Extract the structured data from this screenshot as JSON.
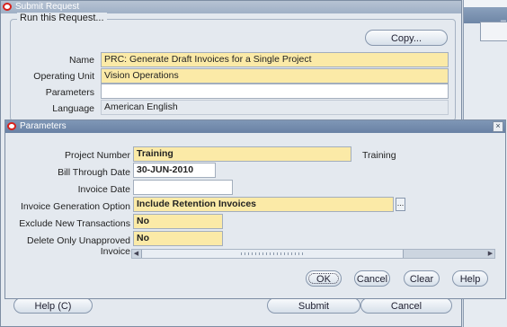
{
  "submit_request": {
    "title": "Submit Request",
    "group_title": "Run this Request...",
    "copy_label": "Copy...",
    "fields": {
      "name_label": "Name",
      "name_value": "PRC: Generate Draft Invoices for a Single Project",
      "operating_unit_label": "Operating Unit",
      "operating_unit_value": "Vision Operations",
      "parameters_label": "Parameters",
      "parameters_value": "",
      "language_label": "Language",
      "language_value": "American English"
    },
    "help_label": "Help (C)",
    "submit_label": "Submit",
    "cancel_label": "Cancel"
  },
  "parameters": {
    "title": "Parameters",
    "fields": [
      {
        "label": "Project Number",
        "value": "Training",
        "description": "Training"
      },
      {
        "label": "Bill Through Date",
        "value": "30-JUN-2010"
      },
      {
        "label": "Invoice Date",
        "value": ""
      },
      {
        "label": "Invoice Generation Option",
        "value": "Include Retention Invoices"
      },
      {
        "label": "Exclude New Transactions",
        "value": "No"
      },
      {
        "label": "Delete Only Unapproved Invoice",
        "value": "No"
      }
    ],
    "lov_label": "...",
    "buttons": {
      "ok": "OK",
      "cancel": "Cancel",
      "clear": "Clear",
      "help": "Help"
    }
  },
  "colors": {
    "required_field": "#fbeaa7",
    "title_bar_active": "#6981a4",
    "title_bar_inactive": "#9fb0c6",
    "oracle_icon": "#d8201a"
  }
}
